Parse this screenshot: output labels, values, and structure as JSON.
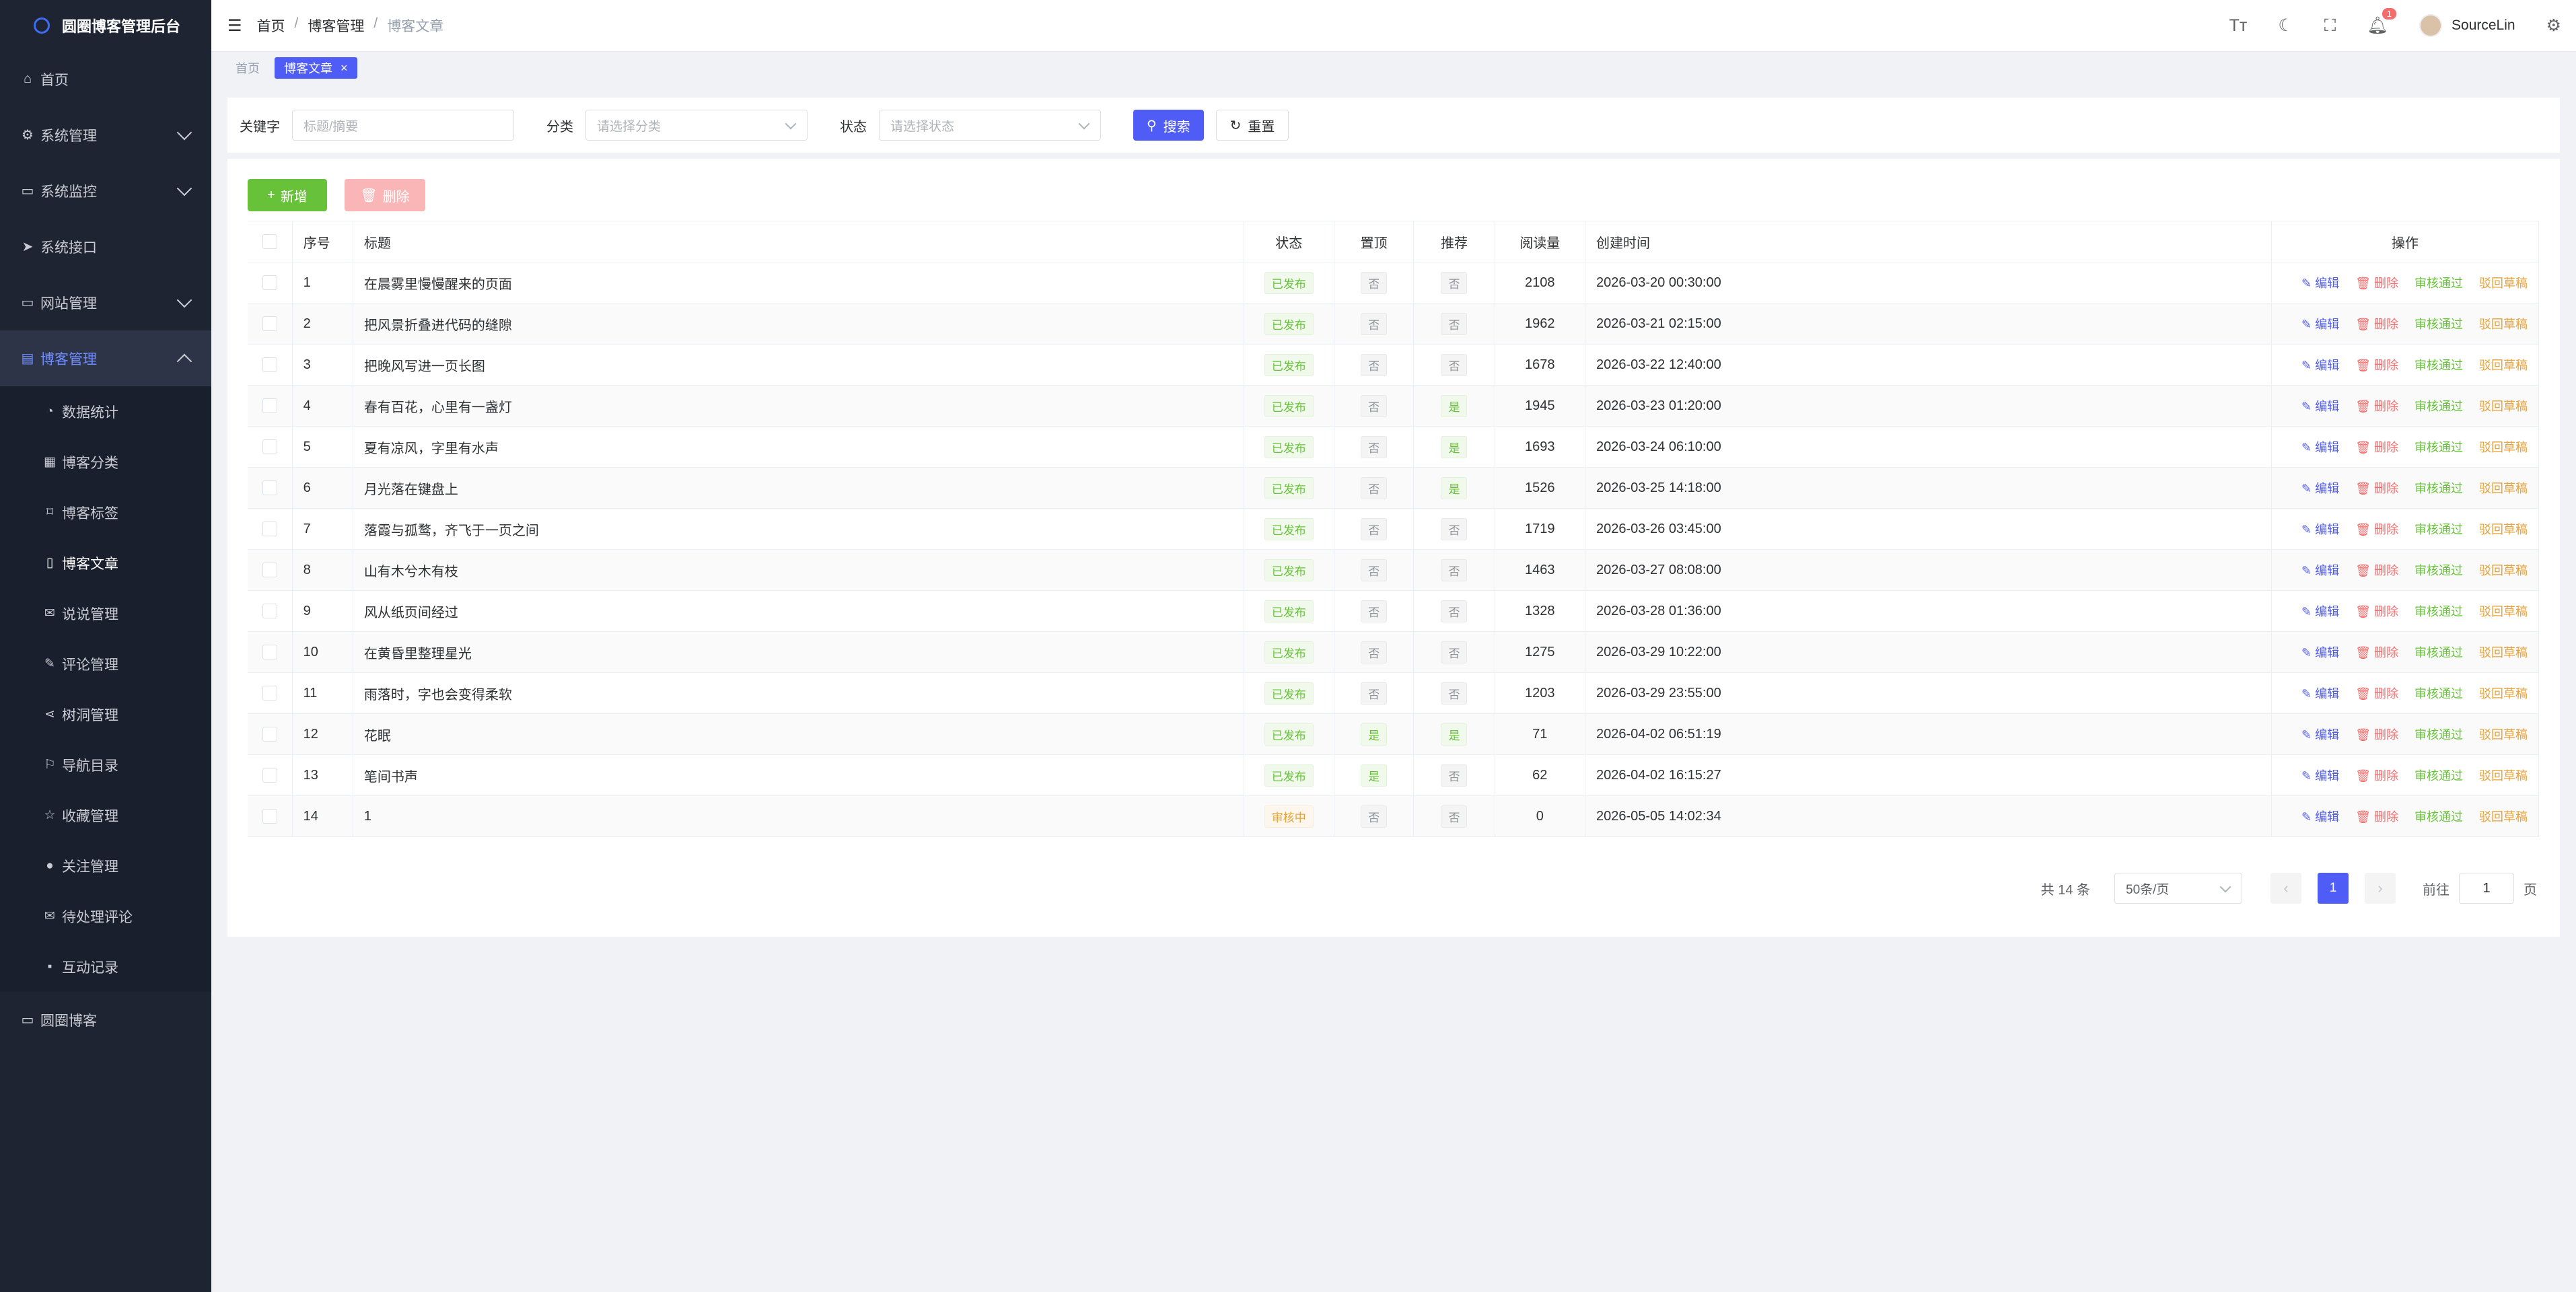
{
  "app_title": "圆圈博客管理后台",
  "sidebar": {
    "top_items": [
      {
        "label": "首页",
        "icon": "home-icon"
      },
      {
        "label": "系统管理",
        "icon": "gear-icon"
      },
      {
        "label": "系统监控",
        "icon": "monitor-icon"
      },
      {
        "label": "系统接口",
        "icon": "send-icon"
      },
      {
        "label": "网站管理",
        "icon": "monitor-icon"
      },
      {
        "label": "博客管理",
        "icon": "document-icon"
      }
    ],
    "sub_items": [
      {
        "label": "数据统计",
        "icon": "chart-icon"
      },
      {
        "label": "博客分类",
        "icon": "grid-icon"
      },
      {
        "label": "博客标签",
        "icon": "bookmark-icon"
      },
      {
        "label": "博客文章",
        "icon": "book-icon"
      },
      {
        "label": "说说管理",
        "icon": "message-icon"
      },
      {
        "label": "评论管理",
        "icon": "edit-icon"
      },
      {
        "label": "树洞管理",
        "icon": "share-icon"
      },
      {
        "label": "导航目录",
        "icon": "guide-icon"
      },
      {
        "label": "收藏管理",
        "icon": "star-icon"
      },
      {
        "label": "关注管理",
        "icon": "user-icon"
      },
      {
        "label": "待处理评论",
        "icon": "message-icon"
      },
      {
        "label": "互动记录",
        "icon": "chat-icon"
      }
    ],
    "bottom_item": {
      "label": "圆圈博客",
      "icon": "monitor-icon"
    }
  },
  "header": {
    "breadcrumb": [
      "首页",
      "博客管理",
      "博客文章"
    ],
    "notification_count": "1",
    "username": "SourceLin"
  },
  "tags": {
    "home": "首页",
    "active": "博客文章"
  },
  "search": {
    "keyword_label": "关键字",
    "keyword_placeholder": "标题/摘要",
    "category_label": "分类",
    "category_placeholder": "请选择分类",
    "status_label": "状态",
    "status_placeholder": "请选择状态",
    "search_button": "搜索",
    "reset_button": "重置"
  },
  "toolbar": {
    "add_label": "新增",
    "delete_label": "删除"
  },
  "table": {
    "headers": {
      "index": "序号",
      "title": "标题",
      "status": "状态",
      "top": "置顶",
      "recommend": "推荐",
      "views": "阅读量",
      "created": "创建时间",
      "actions": "操作"
    },
    "action_labels": {
      "edit": "编辑",
      "delete": "删除",
      "approve": "审核通过",
      "draft": "驳回草稿"
    },
    "rows": [
      {
        "index": "1",
        "title": "在晨雾里慢慢醒来的页面",
        "status": "已发布",
        "top": "否",
        "recommend": "否",
        "views": "2108",
        "created": "2026-03-20 00:30:00"
      },
      {
        "index": "2",
        "title": "把风景折叠进代码的缝隙",
        "status": "已发布",
        "top": "否",
        "recommend": "否",
        "views": "1962",
        "created": "2026-03-21 02:15:00"
      },
      {
        "index": "3",
        "title": "把晚风写进一页长图",
        "status": "已发布",
        "top": "否",
        "recommend": "否",
        "views": "1678",
        "created": "2026-03-22 12:40:00"
      },
      {
        "index": "4",
        "title": "春有百花，心里有一盏灯",
        "status": "已发布",
        "top": "否",
        "recommend": "是",
        "views": "1945",
        "created": "2026-03-23 01:20:00"
      },
      {
        "index": "5",
        "title": "夏有凉风，字里有水声",
        "status": "已发布",
        "top": "否",
        "recommend": "是",
        "views": "1693",
        "created": "2026-03-24 06:10:00"
      },
      {
        "index": "6",
        "title": "月光落在键盘上",
        "status": "已发布",
        "top": "否",
        "recommend": "是",
        "views": "1526",
        "created": "2026-03-25 14:18:00"
      },
      {
        "index": "7",
        "title": "落霞与孤鹜，齐飞于一页之间",
        "status": "已发布",
        "top": "否",
        "recommend": "否",
        "views": "1719",
        "created": "2026-03-26 03:45:00"
      },
      {
        "index": "8",
        "title": "山有木兮木有枝",
        "status": "已发布",
        "top": "否",
        "recommend": "否",
        "views": "1463",
        "created": "2026-03-27 08:08:00"
      },
      {
        "index": "9",
        "title": "风从纸页间经过",
        "status": "已发布",
        "top": "否",
        "recommend": "否",
        "views": "1328",
        "created": "2026-03-28 01:36:00"
      },
      {
        "index": "10",
        "title": "在黄昏里整理星光",
        "status": "已发布",
        "top": "否",
        "recommend": "否",
        "views": "1275",
        "created": "2026-03-29 10:22:00"
      },
      {
        "index": "11",
        "title": "雨落时，字也会变得柔软",
        "status": "已发布",
        "top": "否",
        "recommend": "否",
        "views": "1203",
        "created": "2026-03-29 23:55:00"
      },
      {
        "index": "12",
        "title": "花眠",
        "status": "已发布",
        "top": "是",
        "recommend": "是",
        "views": "71",
        "created": "2026-04-02 06:51:19"
      },
      {
        "index": "13",
        "title": "笔间书声",
        "status": "已发布",
        "top": "是",
        "recommend": "否",
        "views": "62",
        "created": "2026-04-02 16:15:27"
      },
      {
        "index": "14",
        "title": "1",
        "status": "审核中",
        "top": "否",
        "recommend": "否",
        "views": "0",
        "created": "2026-05-05 14:02:34"
      }
    ]
  },
  "pagination": {
    "total_text": "共 14 条",
    "page_size": "50条/页",
    "current_page": "1",
    "goto_label": "前往",
    "goto_value": "1",
    "page_suffix": "页"
  },
  "colors": {
    "primary": "#4f5cf5",
    "success": "#67c23a",
    "danger": "#f56c6c",
    "warning": "#e6a23c",
    "sidebar_bg": "#1f2433"
  }
}
